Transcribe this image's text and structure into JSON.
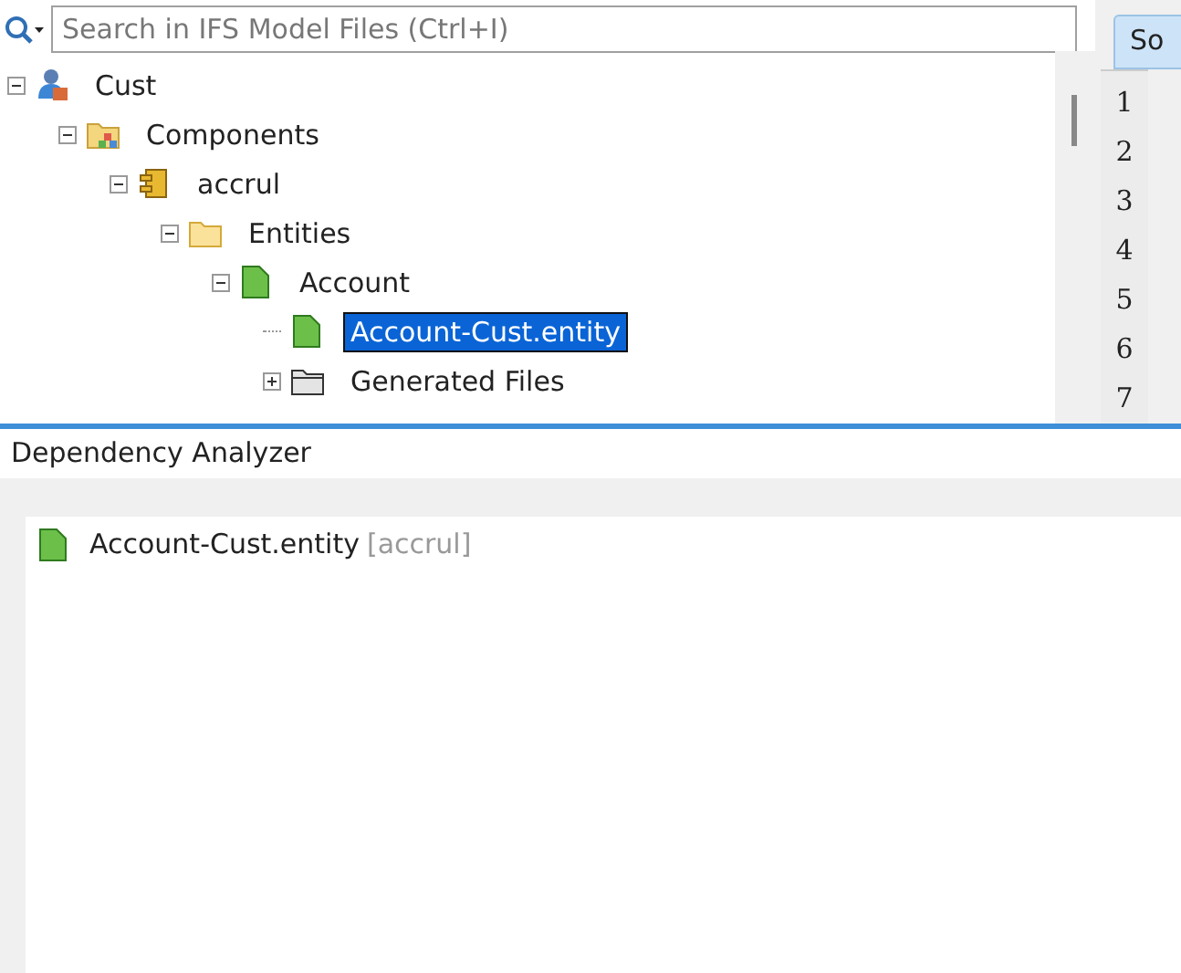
{
  "search": {
    "placeholder": "Search in IFS Model Files (Ctrl+I)"
  },
  "tree": [
    {
      "label": "Cust",
      "kind": "project",
      "expanded": true,
      "selected": false,
      "children": [
        {
          "label": "Components",
          "kind": "components",
          "expanded": true,
          "selected": false,
          "children": [
            {
              "label": "accrul",
              "kind": "component",
              "expanded": true,
              "selected": false,
              "children": [
                {
                  "label": "Entities",
                  "kind": "folder",
                  "expanded": true,
                  "selected": false,
                  "children": [
                    {
                      "label": "Account",
                      "kind": "entity",
                      "expanded": true,
                      "selected": false,
                      "children": [
                        {
                          "label": "Account-Cust.entity",
                          "kind": "file",
                          "selected": true
                        },
                        {
                          "label": "Generated Files",
                          "kind": "generated",
                          "expanded": false,
                          "selected": false
                        }
                      ]
                    }
                  ]
                }
              ]
            }
          ]
        }
      ]
    }
  ],
  "editor": {
    "tab": "So",
    "line_numbers": [
      "1",
      "2",
      "3",
      "4",
      "5",
      "6",
      "7"
    ]
  },
  "dependency_analyzer": {
    "title": "Dependency Analyzer",
    "items": [
      {
        "name": "Account-Cust.entity",
        "module": "[accrul]",
        "kind": "file"
      }
    ]
  }
}
